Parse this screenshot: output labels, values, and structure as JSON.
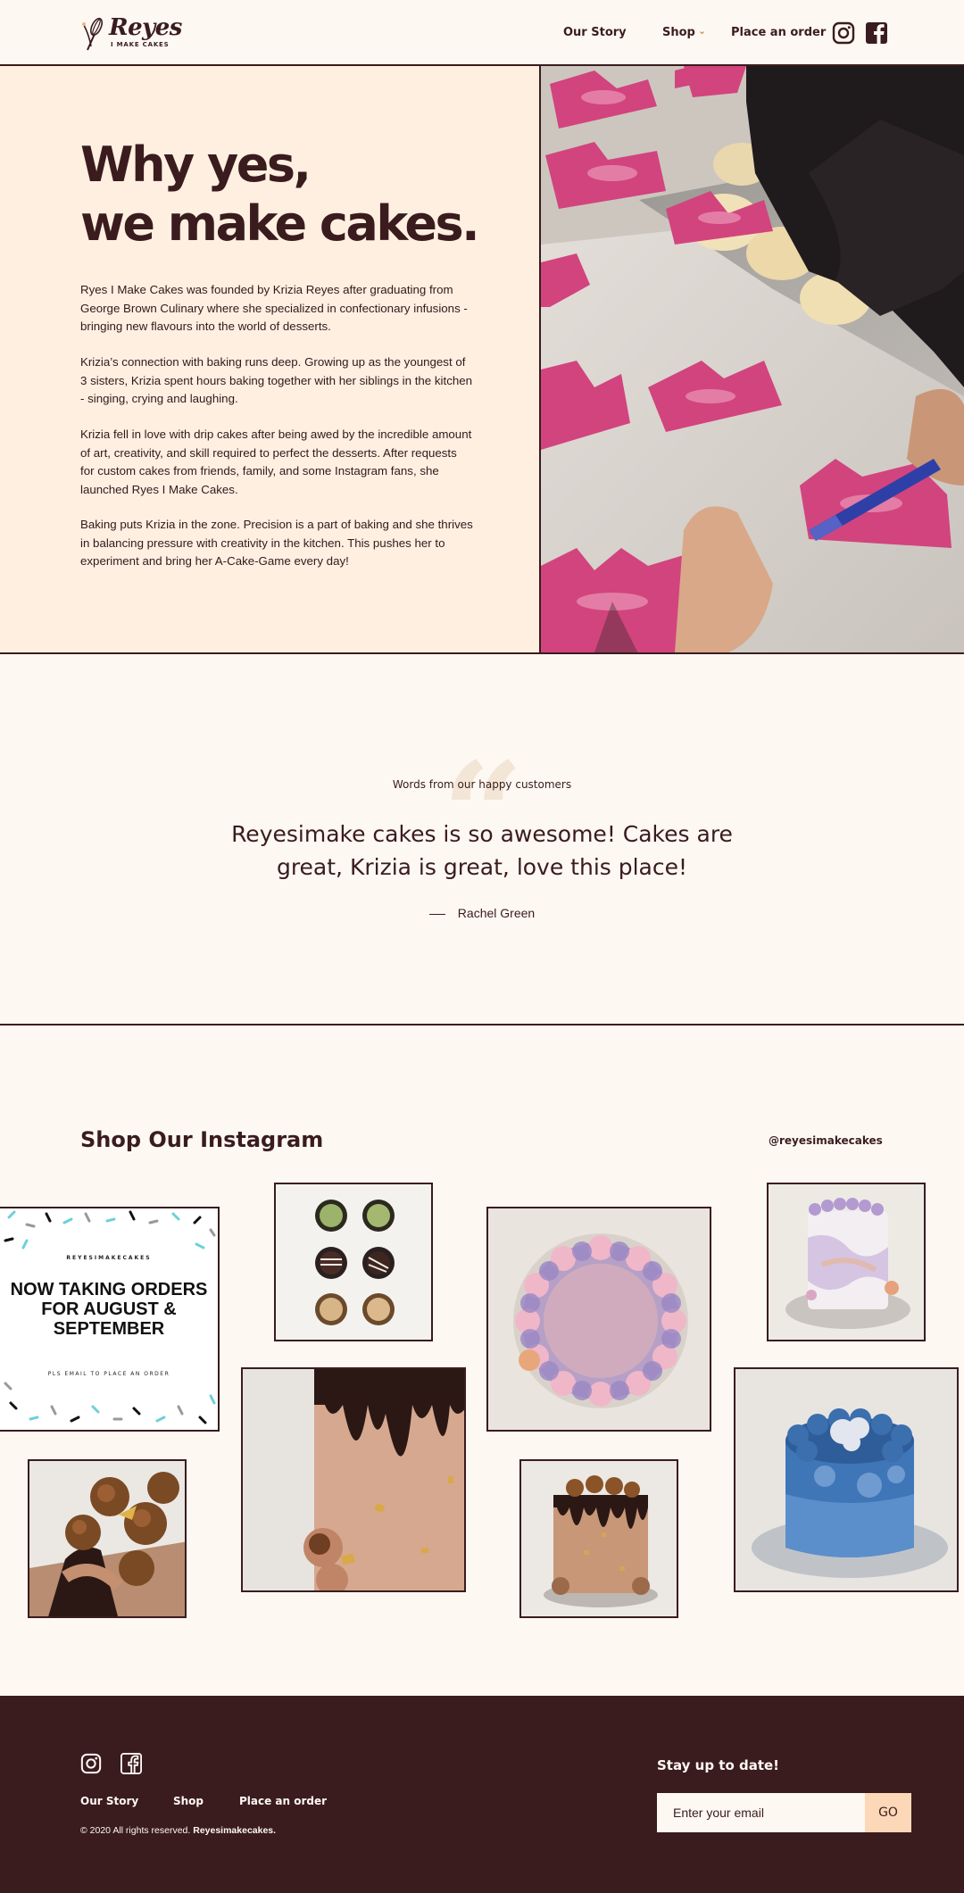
{
  "header": {
    "logo_name": "Reyes",
    "logo_sub": "I MAKE CAKES",
    "nav": [
      {
        "label": "Our Story"
      },
      {
        "label": "Shop"
      },
      {
        "label": "Place an order"
      }
    ],
    "shop_chevron": "⌄",
    "social_icons": [
      "instagram-icon",
      "facebook-icon"
    ]
  },
  "hero": {
    "title_line1": "Why yes,",
    "title_line2": "we make cakes.",
    "paragraphs": [
      "Ryes I Make Cakes was founded by Krizia Reyes after graduating from George Brown Culinary where she specialized in confectionary infusions - bringing new flavours into the world of desserts.",
      "Krizia’s connection with baking runs deep. Growing up as the youngest of 3 sisters, Krizia spent hours baking together with her siblings in the kitchen - singing, crying and laughing.",
      "Krizia fell in love with drip cakes after being awed by the incredible amount of art, creativity, and skill required to perfect the desserts. After requests for custom cakes from friends, family, and some Instagram fans, she launched Ryes I Make Cakes.",
      "Baking puts Krizia in the zone. Precision is a part of baking and she thrives in balancing pressure with creativity in the kitchen. This pushes her to experiment and bring her A-Cake-Game every day!"
    ]
  },
  "testimonial": {
    "quote_glyph": "“",
    "label": "Words from our happy customers",
    "quote": "Reyesimake cakes is so awesome! Cakes are great, Krizia is great, love this place!",
    "author": "Rachel Green"
  },
  "instagram": {
    "title": "Shop Our Instagram",
    "handle": "@reyesimakecakes",
    "promo": {
      "brand": "REYESIMAKECAKES",
      "headline": "NOW TAKING ORDERS FOR AUGUST & SEPTEMBER",
      "sub": "PLS EMAIL TO PLACE AN ORDER"
    }
  },
  "footer": {
    "links": [
      {
        "label": "Our Story"
      },
      {
        "label": "Shop"
      },
      {
        "label": "Place an order"
      }
    ],
    "copyright": "© 2020 All rights reserved.",
    "copyright_brand": "Reyesimakecakes.",
    "newsletter_title": "Stay up to date!",
    "email_placeholder": "Enter your email",
    "go_label": "GO"
  },
  "colors": {
    "brand_dark": "#3a1c1e",
    "cream": "#fef8f2",
    "peach": "#feefe1",
    "button_peach": "#fcd8b8"
  }
}
